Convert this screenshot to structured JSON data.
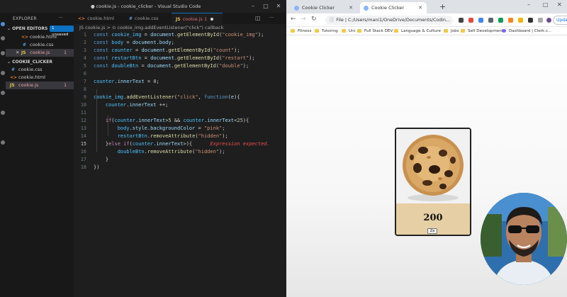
{
  "vscode": {
    "window_title": "● cookie.js - cookie_clicker - Visual Studio Code",
    "sidebar": {
      "header": "EXPLORER",
      "open_editors_label": "OPEN EDITORS",
      "unsaved_badge": "1 unsaved",
      "open_editors": [
        {
          "icon": "<>",
          "name": "cookie.html",
          "errors": ""
        },
        {
          "icon": "#",
          "name": "cookie.css",
          "errors": ""
        },
        {
          "icon": "JS",
          "name": "cookie.js",
          "errors": "1"
        }
      ],
      "folder_label": "COOKIE_CLICKER",
      "files": [
        {
          "icon": "#",
          "name": "cookie.css",
          "errors": ""
        },
        {
          "icon": "<>",
          "name": "cookie.html",
          "errors": ""
        },
        {
          "icon": "JS",
          "name": "cookie.js",
          "errors": "1"
        }
      ]
    },
    "tabs": [
      {
        "icon": "<>",
        "name": "cookie.html"
      },
      {
        "icon": "#",
        "name": "cookie.css"
      },
      {
        "icon": "JS",
        "name": "cookie.js 1"
      }
    ],
    "breadcrumb": "JS cookie.js > ⊙ cookie_img.addEventListener(\"click\") callback",
    "line_numbers": [
      "1",
      "2",
      "3",
      "4",
      "5",
      "6",
      "7",
      "8",
      "9",
      "10",
      "11",
      "12",
      "13",
      "14",
      "15",
      "16",
      "17",
      "18"
    ],
    "error_message": "Expression expected."
  },
  "chrome": {
    "tabs": [
      {
        "title": "Cookie Clicker"
      },
      {
        "title": "Cookie Clicker"
      }
    ],
    "new_tab": "+",
    "address": "File  |  C:/Users/mani1/OneDrive/Documents/Codin...",
    "update_label": "Upda",
    "bookmarks": [
      "Fitness",
      "Tutoring",
      "Uni",
      "Full Stack DEV",
      "Language & Culture",
      "Jobs",
      "Self Development",
      "Dashboard | Clerk.c..."
    ]
  },
  "page": {
    "count": "200",
    "double_button": "2x"
  },
  "colors": {
    "vscode_bg": "#1e1e1e",
    "accent": "#0e70c0",
    "error": "#f14c4c",
    "counter_bg": "#e6cfa5"
  }
}
